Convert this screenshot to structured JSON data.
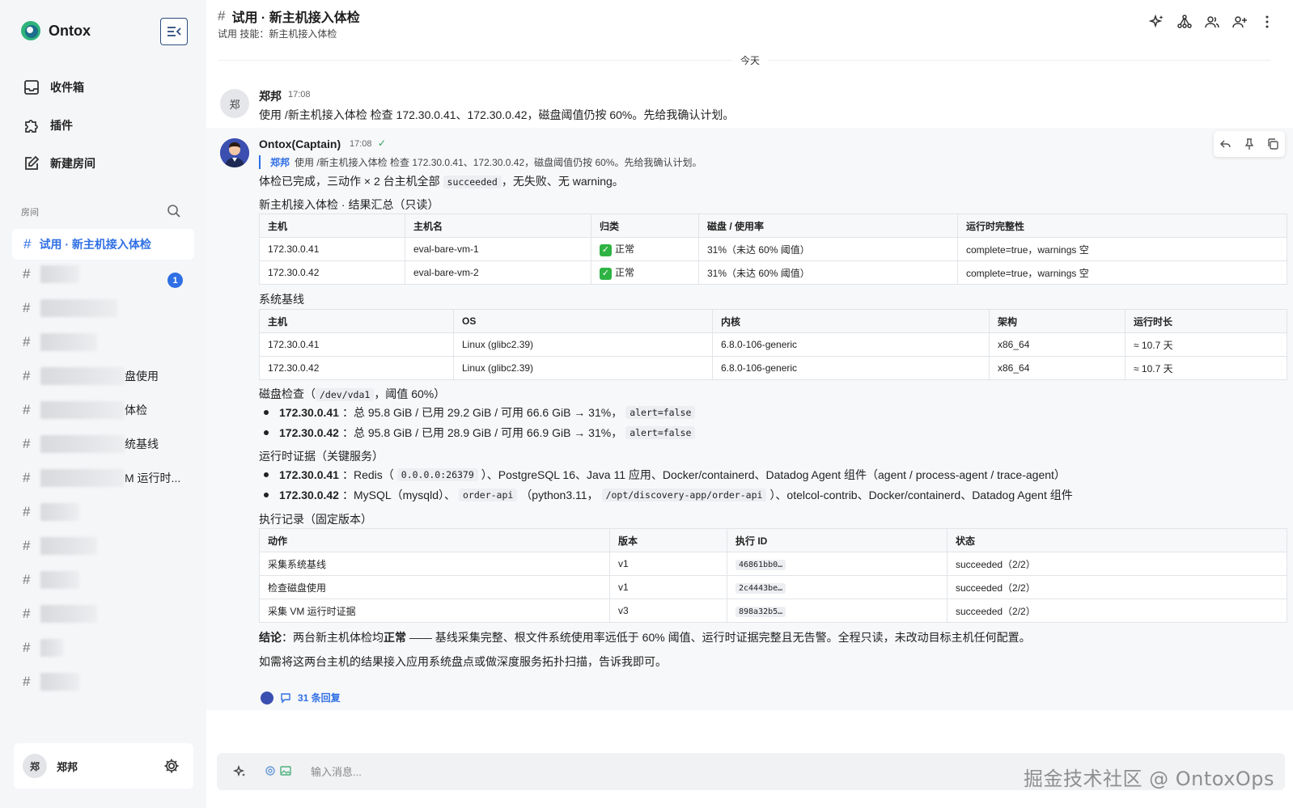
{
  "app": {
    "brand_name": "Ontox",
    "accent": "#2f6fe4"
  },
  "sidebar": {
    "nav": [
      {
        "label": "收件箱",
        "icon": "inbox-icon"
      },
      {
        "label": "插件",
        "icon": "puzzle-icon"
      },
      {
        "label": "新建房间",
        "icon": "edit-icon"
      }
    ],
    "rooms_label": "房间",
    "active_room": "试用 · 新主机接入体检",
    "unread_count": "1",
    "room_suffixes": [
      "盘使用",
      "体检",
      "统基线",
      "M 运行时..."
    ],
    "user_avatar": "郑",
    "user_name": "郑邦"
  },
  "header": {
    "title": "试用 · 新主机接入体检",
    "subtitle": "试用 技能：新主机接入体检"
  },
  "chat": {
    "day_label": "今天",
    "msg1": {
      "avatar": "郑",
      "name": "郑邦",
      "time": "17:08",
      "text": "使用 /新主机接入体检 检查 172.30.0.41、172.30.0.42，磁盘阈值仍按 60%。先给我确认计划。"
    },
    "bot": {
      "name": "Ontox(Captain)",
      "time": "17:08",
      "check": "✓",
      "quote_name": "郑邦",
      "quote_text": "使用 /新主机接入体检 检查 172.30.0.41、172.30.0.42，磁盘阈值仍按 60%。先给我确认计划。",
      "summary_pre": "体检已完成，三动作 × 2 台主机全部",
      "summary_code": "succeeded",
      "summary_post": "，无失败、无 warning。",
      "table1": {
        "title": "新主机接入体检 · 结果汇总（只读）",
        "headers": [
          "主机",
          "主机名",
          "归类",
          "磁盘 / 使用率",
          "运行时完整性"
        ],
        "rows": [
          [
            "172.30.0.41",
            "eval-bare-vm-1",
            "正常",
            "31%（未达 60% 阈值）",
            "complete=true，warnings 空"
          ],
          [
            "172.30.0.42",
            "eval-bare-vm-2",
            "正常",
            "31%（未达 60% 阈值）",
            "complete=true，warnings 空"
          ]
        ]
      },
      "table2": {
        "title": "系统基线",
        "headers": [
          "主机",
          "OS",
          "内核",
          "架构",
          "运行时长"
        ],
        "rows": [
          [
            "172.30.0.41",
            "Linux (glibc2.39)",
            "6.8.0-106-generic",
            "x86_64",
            "≈ 10.7 天"
          ],
          [
            "172.30.0.42",
            "Linux (glibc2.39)",
            "6.8.0-106-generic",
            "x86_64",
            "≈ 10.7 天"
          ]
        ]
      },
      "disk": {
        "title_pre": "磁盘检查（",
        "title_code": "/dev/vda1",
        "title_post": "，阈值 60%）",
        "items": [
          {
            "host": "172.30.0.41",
            "text": "：总 95.8 GiB / 已用 29.2 GiB / 可用 66.6 GiB → 31%，",
            "code": "alert=false"
          },
          {
            "host": "172.30.0.42",
            "text": "：总 95.8 GiB / 已用 28.9 GiB / 可用 66.9 GiB → 31%，",
            "code": "alert=false"
          }
        ]
      },
      "runtime": {
        "title": "运行时证据（关键服务）",
        "item1": {
          "host": "172.30.0.41",
          "pre": "：Redis（",
          "code": "0.0.0.0:26379",
          "post": "）、PostgreSQL 16、Java 11 应用、Docker/containerd、Datadog Agent 组件（agent / process-agent / trace-agent）"
        },
        "item2": {
          "host": "172.30.0.42",
          "pre": "：MySQL（mysqld）、",
          "code1": "order-api",
          "mid": "（python3.11，",
          "code2": "/opt/discovery-app/order-api",
          "post": "）、otelcol-contrib、Docker/containerd、Datadog Agent 组件"
        }
      },
      "table3": {
        "title": "执行记录（固定版本）",
        "headers": [
          "动作",
          "版本",
          "执行 ID",
          "状态"
        ],
        "rows": [
          [
            "采集系统基线",
            "v1",
            "46861bb0…",
            "succeeded（2/2）"
          ],
          [
            "检查磁盘使用",
            "v1",
            "2c4443be…",
            "succeeded（2/2）"
          ],
          [
            "采集 VM 运行时证据",
            "v3",
            "898a32b5…",
            "succeeded（2/2）"
          ]
        ]
      },
      "conclusion_label": "结论",
      "conclusion_pre": "：两台新主机体检均",
      "conclusion_bold": "正常",
      "conclusion_post": " —— 基线采集完整、根文件系统使用率远低于 60% 阈值、运行时证据完整且无告警。全程只读，未改动目标主机任何配置。",
      "followup": "如需将这两台主机的结果接入应用系统盘点或做深度服务拓扑扫描，告诉我即可。",
      "replies_label": "31 条回复"
    }
  },
  "composer": {
    "placeholder": "输入消息..."
  },
  "watermark": "掘金技术社区 @ OntoxOps"
}
